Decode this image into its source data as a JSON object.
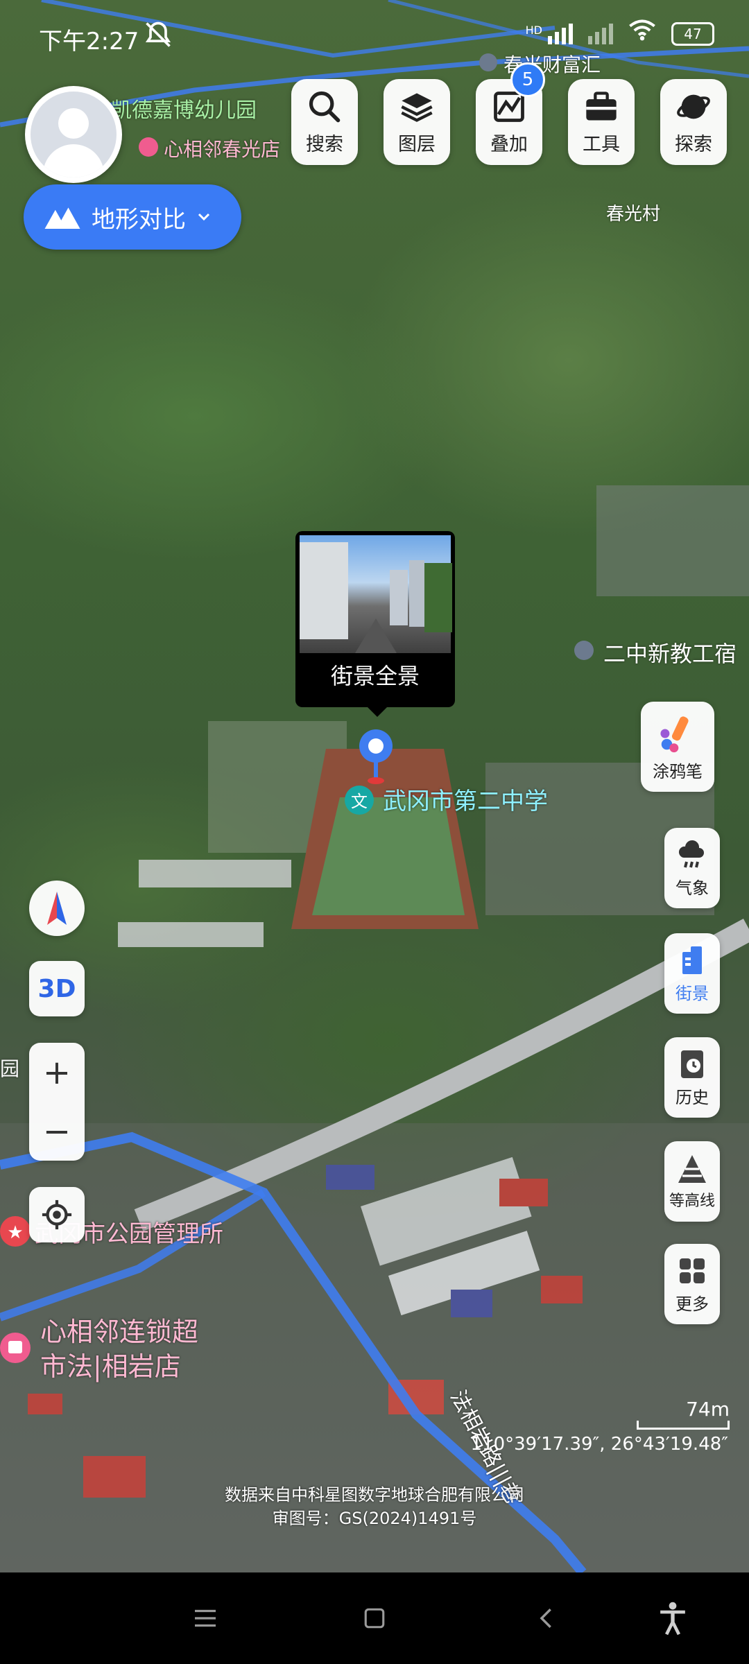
{
  "status_bar": {
    "time": "下午2:27",
    "network_badge": "HD",
    "battery": "47"
  },
  "top_toolbar": {
    "buttons": [
      {
        "label": "搜索",
        "icon": "search-icon"
      },
      {
        "label": "图层",
        "icon": "layers-icon"
      },
      {
        "label": "叠加",
        "icon": "overlay-icon",
        "badge": "5"
      },
      {
        "label": "工具",
        "icon": "toolbox-icon"
      },
      {
        "label": "探索",
        "icon": "planet-icon"
      }
    ]
  },
  "terrain_compare": {
    "label": "地形对比"
  },
  "right_tools": [
    {
      "label": "涂鸦笔",
      "icon": "brush-icon"
    },
    {
      "label": "气象",
      "icon": "weather-icon"
    },
    {
      "label": "街景",
      "icon": "street-view-icon"
    },
    {
      "label": "历史",
      "icon": "history-icon"
    },
    {
      "label": "等高线",
      "icon": "contour-icon"
    },
    {
      "label": "更多",
      "icon": "grid-icon"
    }
  ],
  "left_tools": {
    "mode_3d": "3D",
    "zoom_in": "+",
    "zoom_out": "−"
  },
  "map_labels": {
    "kindergarten": "凯德嘉博幼儿园",
    "store_top": "心相邻春光店",
    "chunguang_caifu": "春光财富汇",
    "chunguang_village": "春光村",
    "er_zhong_dorm": "二中新教工宿",
    "school": "武冈市第二中学",
    "park_office": "武冈市公园管理所",
    "supermarket_line1": "心相邻连锁超",
    "supermarket_line2": "市法|相岩店",
    "road": "法相岩路|||巷",
    "left_edge_fragment": "园"
  },
  "street_view_popup": {
    "label": "街景全景"
  },
  "scale": {
    "distance": "74m"
  },
  "coordinates": "110°39′17.39″, 26°43′19.48″",
  "attribution": {
    "line1": "数据来自中科星图数字地球合肥有限公司",
    "line2": "审图号：GS(2024)1491号"
  },
  "colors": {
    "accent": "#3a7bf5",
    "route": "#3f7df0",
    "poi_pink": "#ffb9d2",
    "poi_cyan": "#8ef0ff"
  }
}
